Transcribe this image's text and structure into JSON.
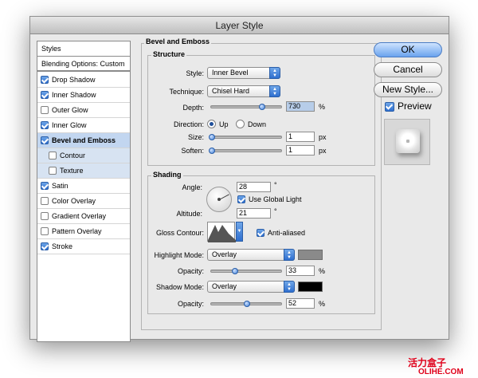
{
  "window": {
    "title": "Layer Style"
  },
  "sidebar": {
    "header": "Styles",
    "blending": "Blending Options: Custom",
    "items": [
      {
        "label": "Drop Shadow",
        "checked": true
      },
      {
        "label": "Inner Shadow",
        "checked": true
      },
      {
        "label": "Outer Glow",
        "checked": false
      },
      {
        "label": "Inner Glow",
        "checked": true
      },
      {
        "label": "Bevel and Emboss",
        "checked": true,
        "selected": true
      },
      {
        "label": "Contour",
        "checked": false,
        "sub": true
      },
      {
        "label": "Texture",
        "checked": false,
        "sub": true
      },
      {
        "label": "Satin",
        "checked": true
      },
      {
        "label": "Color Overlay",
        "checked": false
      },
      {
        "label": "Gradient Overlay",
        "checked": false
      },
      {
        "label": "Pattern Overlay",
        "checked": false
      },
      {
        "label": "Stroke",
        "checked": true
      }
    ]
  },
  "bevel": {
    "title": "Bevel and Emboss",
    "structure": {
      "title": "Structure",
      "style_label": "Style:",
      "style_value": "Inner Bevel",
      "technique_label": "Technique:",
      "technique_value": "Chisel Hard",
      "depth_label": "Depth:",
      "depth_value": "730",
      "depth_unit": "%",
      "depth_level": 0.7,
      "direction_label": "Direction:",
      "direction_up": "Up",
      "direction_down": "Down",
      "size_label": "Size:",
      "size_value": "1",
      "size_unit": "px",
      "soften_label": "Soften:",
      "soften_value": "1",
      "soften_unit": "px"
    },
    "shading": {
      "title": "Shading",
      "angle_label": "Angle:",
      "angle_value": "28",
      "angle_unit": "°",
      "global_light_label": "Use Global Light",
      "altitude_label": "Altitude:",
      "altitude_value": "21",
      "altitude_unit": "°",
      "gloss_label": "Gloss Contour:",
      "antialiased_label": "Anti-aliased",
      "highlight_label": "Highlight Mode:",
      "highlight_value": "Overlay",
      "highlight_color": "#8a8a8a",
      "hl_opacity_label": "Opacity:",
      "hl_opacity_value": "33",
      "hl_opacity_unit": "%",
      "shadow_label": "Shadow Mode:",
      "shadow_value": "Overlay",
      "shadow_color": "#000000",
      "sh_opacity_label": "Opacity:",
      "sh_opacity_value": "52",
      "sh_opacity_unit": "%"
    }
  },
  "buttons": {
    "ok": "OK",
    "cancel": "Cancel",
    "new_style": "New Style...",
    "preview": "Preview"
  },
  "watermark": {
    "cn": "活力盒子",
    "en": "OLIHE.COM"
  }
}
